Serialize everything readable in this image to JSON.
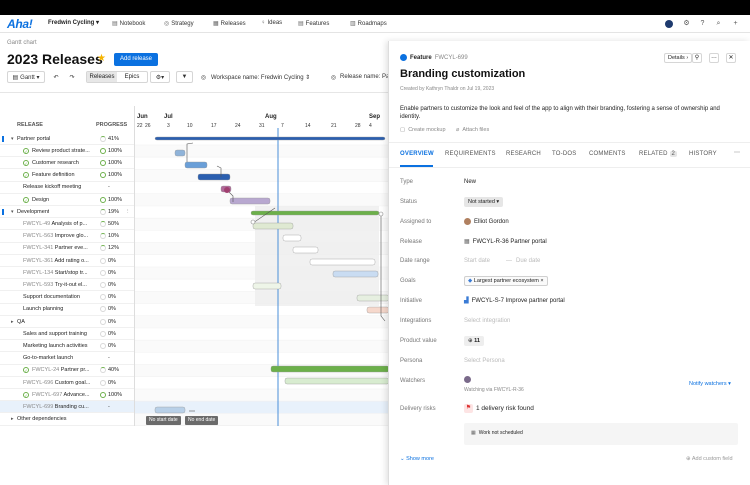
{
  "nav": {
    "logo": "Aha!",
    "workspace": "Fredwin Cycling ▾",
    "items": [
      {
        "label": "Notebook",
        "icon": "notebook-icon",
        "glyph": "▤"
      },
      {
        "label": "Strategy",
        "icon": "strategy-icon",
        "glyph": "◎"
      },
      {
        "label": "Releases",
        "icon": "releases-icon",
        "glyph": "▦"
      },
      {
        "label": "Ideas",
        "icon": "ideas-icon",
        "glyph": "♀"
      },
      {
        "label": "Features",
        "icon": "features-icon",
        "glyph": "▤"
      },
      {
        "label": "Roadmaps",
        "icon": "roadmaps-icon",
        "glyph": "▥"
      }
    ]
  },
  "page": {
    "breadcrumb": "Gantt chart",
    "title": "2023 Releases",
    "add_release": "Add release"
  },
  "toolbar": {
    "view": "Gantt ▾",
    "tab_releases": "Releases",
    "tab_epics": "Epics",
    "filter_workspace": "Workspace name: Fredwin Cycling ⇕",
    "filter_release": "Release name: Pa"
  },
  "gantt": {
    "col_release": "RELEASE",
    "col_progress": "PROGRESS",
    "months": [
      "Jun",
      "Jul",
      "Aug",
      "Sep"
    ],
    "days": [
      "22",
      "26",
      "3",
      "10",
      "17",
      "24",
      "31",
      "7",
      "14",
      "21",
      "28",
      "4"
    ],
    "rows": [
      {
        "name": "Partner portal",
        "progress": "41%",
        "ring": "part",
        "indent": 0,
        "caret": "▾",
        "check": false,
        "id": ""
      },
      {
        "name": "Review product strate...",
        "progress": "100%",
        "ring": "full",
        "indent": 1,
        "caret": "",
        "check": true,
        "id": ""
      },
      {
        "name": "Customer research",
        "progress": "100%",
        "ring": "full",
        "indent": 1,
        "caret": "",
        "check": true,
        "id": ""
      },
      {
        "name": "Feature definition",
        "progress": "100%",
        "ring": "full",
        "indent": 1,
        "caret": "",
        "check": true,
        "id": ""
      },
      {
        "name": "Release kickoff meeting",
        "progress": "-",
        "ring": "",
        "indent": 1,
        "caret": "",
        "check": false,
        "id": ""
      },
      {
        "name": "Design",
        "progress": "100%",
        "ring": "full",
        "indent": 1,
        "caret": "",
        "check": true,
        "id": ""
      },
      {
        "name": "Development",
        "progress": "19%",
        "ring": "part",
        "indent": 0,
        "caret": "▾",
        "check": false,
        "id": ""
      },
      {
        "name": "Analysis of p...",
        "progress": "50%",
        "ring": "part",
        "indent": 2,
        "caret": "",
        "check": false,
        "id": "FWCYL-49"
      },
      {
        "name": "Improve glo...",
        "progress": "10%",
        "ring": "part",
        "indent": 2,
        "caret": "",
        "check": false,
        "id": "FWCYL-563"
      },
      {
        "name": "Partner eve...",
        "progress": "12%",
        "ring": "part",
        "indent": 2,
        "caret": "",
        "check": false,
        "id": "FWCYL-341"
      },
      {
        "name": "Add rating o...",
        "progress": "0%",
        "ring": "none",
        "indent": 2,
        "caret": "",
        "check": false,
        "id": "FWCYL-361"
      },
      {
        "name": "Start/stop tr...",
        "progress": "0%",
        "ring": "none",
        "indent": 2,
        "caret": "",
        "check": false,
        "id": "FWCYL-134"
      },
      {
        "name": "Try-it-out el...",
        "progress": "0%",
        "ring": "none",
        "indent": 2,
        "caret": "",
        "check": false,
        "id": "FWCYL-593"
      },
      {
        "name": "Support documentation",
        "progress": "0%",
        "ring": "none",
        "indent": 1,
        "caret": "",
        "check": false,
        "id": ""
      },
      {
        "name": "Launch planning",
        "progress": "0%",
        "ring": "none",
        "indent": 1,
        "caret": "",
        "check": false,
        "id": ""
      },
      {
        "name": "QA",
        "progress": "0%",
        "ring": "none",
        "indent": 0,
        "caret": "▸",
        "check": false,
        "id": ""
      },
      {
        "name": "Sales and support training",
        "progress": "0%",
        "ring": "none",
        "indent": 1,
        "caret": "",
        "check": false,
        "id": ""
      },
      {
        "name": "Marketing launch activities",
        "progress": "0%",
        "ring": "none",
        "indent": 1,
        "caret": "",
        "check": false,
        "id": ""
      },
      {
        "name": "Go-to-market launch",
        "progress": "-",
        "ring": "",
        "indent": 1,
        "caret": "",
        "check": false,
        "id": ""
      },
      {
        "name": "Partner pr...",
        "progress": "40%",
        "ring": "part",
        "indent": 2,
        "caret": "",
        "check": true,
        "id": "FWCYL-24"
      },
      {
        "name": "Custom goal...",
        "progress": "0%",
        "ring": "none",
        "indent": 2,
        "caret": "",
        "check": false,
        "id": "FWCYL-696"
      },
      {
        "name": "Advance...",
        "progress": "100%",
        "ring": "full",
        "indent": 2,
        "caret": "",
        "check": true,
        "id": "FWCYL-697"
      },
      {
        "name": "Branding cu...",
        "progress": "-",
        "ring": "",
        "indent": 2,
        "caret": "",
        "check": false,
        "id": "FWCYL-699"
      },
      {
        "name": "Other dependencies",
        "progress": "",
        "ring": "",
        "indent": 0,
        "caret": "▸",
        "check": false,
        "id": ""
      }
    ],
    "no_start": "No start date",
    "no_end": "No end date"
  },
  "panel": {
    "type_label": "Feature",
    "ref": "FWCYL-699",
    "details_btn": "Details ›",
    "title": "Branding customization",
    "created": "Created by Kathryn Thaldr on Jul 19, 2023",
    "description": "Enable partners to customize the look and feel of the app to align with their branding, fostering a sense of ownership and identity.",
    "create_mockup": "Create mockup",
    "attach_files": "Attach files",
    "tabs": [
      "OVERVIEW",
      "REQUIREMENTS",
      "RESEARCH",
      "TO-DOS",
      "COMMENTS",
      "RELATED",
      "HISTORY"
    ],
    "related_count": "2",
    "fields": {
      "type": {
        "label": "Type",
        "value": "New"
      },
      "status": {
        "label": "Status",
        "value": "Not started ▾"
      },
      "assigned": {
        "label": "Assigned to",
        "value": "Elliot Gordon"
      },
      "release": {
        "label": "Release",
        "value": "FWCYL-R-36 Partner portal"
      },
      "date_range": {
        "label": "Date range",
        "start": "Start date",
        "end": "Due date"
      },
      "goals": {
        "label": "Goals",
        "value": "Largest partner ecosystem ×"
      },
      "initiative": {
        "label": "Initiative",
        "value": "FWCYL-S-7 Improve partner portal"
      },
      "integrations": {
        "label": "Integrations",
        "value": "Select integration"
      },
      "product_value": {
        "label": "Product value",
        "value": "11"
      },
      "persona": {
        "label": "Persona",
        "value": "Select Persona"
      },
      "watchers": {
        "label": "Watchers",
        "via": "Watching via FWCYL-R-36",
        "notify": "Notify watchers ▾"
      },
      "delivery": {
        "label": "Delivery risks",
        "value": "1 delivery risk found",
        "sub": "Work not scheduled"
      }
    },
    "show_more": "Show more",
    "add_field": "Add custom field"
  },
  "colors": {
    "accent": "#0b71e0",
    "green": "#6cb04a",
    "star": "#f5b400"
  }
}
